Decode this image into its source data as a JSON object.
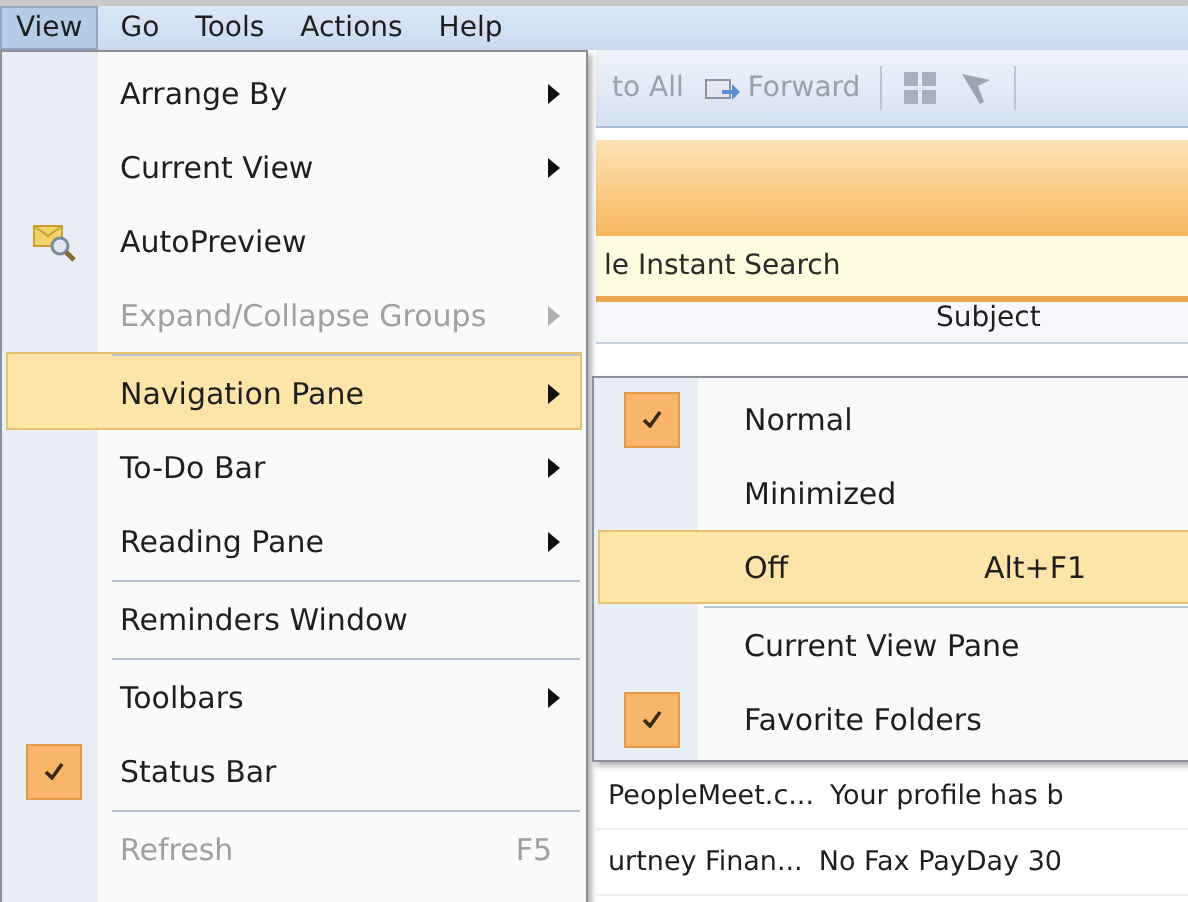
{
  "menubar": [
    {
      "label": "View",
      "selected": true
    },
    {
      "label": "Go",
      "selected": false
    },
    {
      "label": "Tools",
      "selected": false
    },
    {
      "label": "Actions",
      "selected": false
    },
    {
      "label": "Help",
      "selected": false
    }
  ],
  "toolbar": {
    "reply_all": "to All",
    "forward": "Forward"
  },
  "search": {
    "placeholder": "le Instant Search"
  },
  "column_header": "Subject",
  "messages": [
    {
      "from": "PeopleMeet.c...",
      "subject": "Your profile has b"
    },
    {
      "from": "urtney Finan...",
      "subject": "No Fax PayDay 30"
    }
  ],
  "view_menu": [
    {
      "label": "Arrange By",
      "kind": "plain",
      "submenu": true,
      "disabled": false,
      "checked": false,
      "selected": false,
      "separator_before": false
    },
    {
      "label": "Current View",
      "kind": "plain",
      "submenu": true,
      "disabled": false,
      "checked": false,
      "selected": false,
      "separator_before": false
    },
    {
      "label": "AutoPreview",
      "kind": "with-icon",
      "submenu": false,
      "disabled": false,
      "checked": false,
      "selected": false,
      "separator_before": false
    },
    {
      "label": "Expand/Collapse Groups",
      "kind": "plain",
      "submenu": true,
      "disabled": true,
      "checked": false,
      "selected": false,
      "separator_before": false
    },
    {
      "label": "Navigation Pane",
      "kind": "plain",
      "submenu": true,
      "disabled": false,
      "checked": false,
      "selected": true,
      "separator_before": true
    },
    {
      "label": "To-Do Bar",
      "kind": "plain",
      "submenu": true,
      "disabled": false,
      "checked": false,
      "selected": false,
      "separator_before": false
    },
    {
      "label": "Reading Pane",
      "kind": "plain",
      "submenu": true,
      "disabled": false,
      "checked": false,
      "selected": false,
      "separator_before": false
    },
    {
      "label": "Reminders Window",
      "kind": "plain",
      "submenu": false,
      "disabled": false,
      "checked": false,
      "selected": false,
      "separator_before": true
    },
    {
      "label": "Toolbars",
      "kind": "plain",
      "submenu": true,
      "disabled": false,
      "checked": false,
      "selected": false,
      "separator_before": true
    },
    {
      "label": "Status Bar",
      "kind": "plain",
      "submenu": false,
      "disabled": false,
      "checked": true,
      "selected": false,
      "separator_before": false
    },
    {
      "label": "Refresh",
      "kind": "plain",
      "submenu": false,
      "disabled": true,
      "checked": false,
      "selected": false,
      "separator_before": true,
      "shortcut": "F5"
    }
  ],
  "navigation_pane_menu": [
    {
      "label": "Normal",
      "checked": true,
      "selected": false,
      "separator_before": false
    },
    {
      "label": "Minimized",
      "checked": false,
      "selected": false,
      "separator_before": false
    },
    {
      "label": "Off",
      "checked": false,
      "selected": true,
      "separator_before": false,
      "shortcut": "Alt+F1"
    },
    {
      "label": "Current View Pane",
      "checked": false,
      "selected": false,
      "separator_before": true
    },
    {
      "label": "Favorite Folders",
      "checked": true,
      "selected": false,
      "separator_before": false
    }
  ]
}
